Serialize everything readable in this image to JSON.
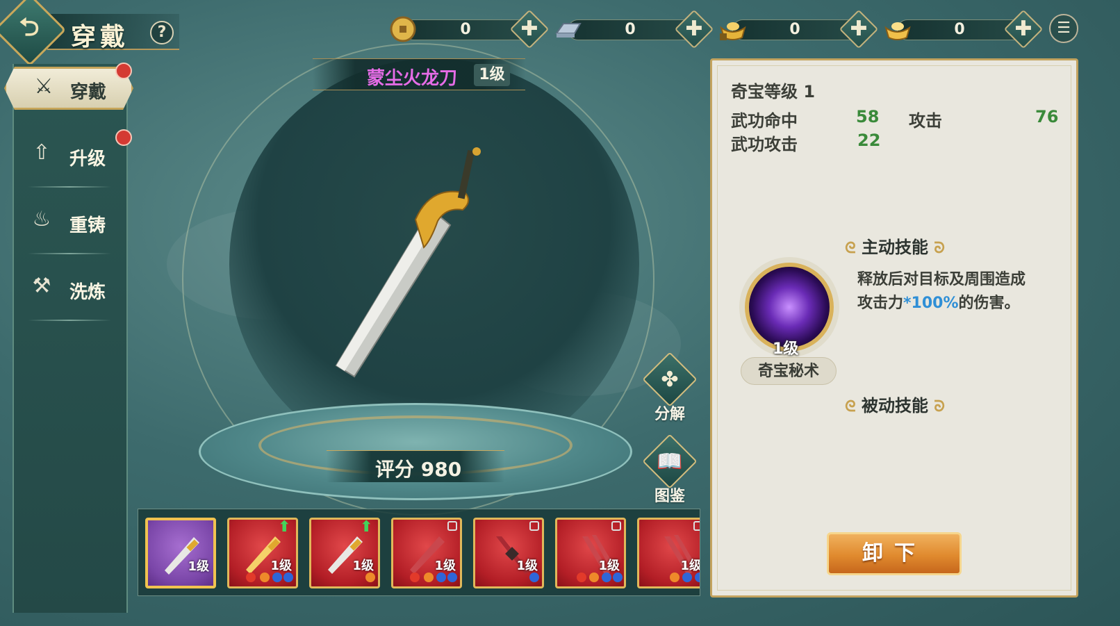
{
  "header": {
    "back_icon": "back-arrow-icon",
    "title": "穿戴",
    "help": "?"
  },
  "currencies": [
    {
      "icon": "copper-coin-icon",
      "value": "0",
      "color": "#e0b64a"
    },
    {
      "icon": "silver-ingot-icon",
      "value": "0",
      "color": "#b9c9da"
    },
    {
      "icon": "gold-ingot-locked-icon",
      "value": "0",
      "color": "#e6b43a"
    },
    {
      "icon": "gold-ingot-icon",
      "value": "0",
      "color": "#f1c04a"
    }
  ],
  "sidebar": {
    "items": [
      {
        "label": "穿戴",
        "icon": "crossed-swords-icon",
        "badge": true
      },
      {
        "label": "升级",
        "icon": "upgrade-arrow-icon",
        "badge": true
      },
      {
        "label": "重铸",
        "icon": "flame-icon",
        "badge": false
      },
      {
        "label": "洗炼",
        "icon": "anvil-icon",
        "badge": false
      }
    ]
  },
  "item": {
    "name": "蒙尘火龙刀",
    "level": "1级",
    "score": "评分 980",
    "name_color": "#e56ce6"
  },
  "actions": {
    "decompose": "分解",
    "codex": "图鉴"
  },
  "inventory": [
    {
      "level": "1级",
      "rarity": "purple",
      "selected": true
    },
    {
      "level": "1级",
      "rarity": "red",
      "upgradable": true
    },
    {
      "level": "1级",
      "rarity": "red",
      "upgradable": true
    },
    {
      "level": "1级",
      "rarity": "red",
      "locked": true
    },
    {
      "level": "1级",
      "rarity": "red",
      "locked": true
    },
    {
      "level": "1级",
      "rarity": "red",
      "locked": true
    },
    {
      "level": "1级",
      "rarity": "red",
      "locked": true
    }
  ],
  "panel": {
    "treasure_level": "奇宝等级 1",
    "stats": [
      {
        "name": "武功命中",
        "value": "58"
      },
      {
        "name": "攻击",
        "value": "76"
      },
      {
        "name": "武功攻击",
        "value": "22"
      }
    ],
    "active_skill_header": "主动技能",
    "skill": {
      "level": "1级",
      "name": "奇宝秘术",
      "desc_line1": "释放后对目标及周围造成",
      "desc_line2_pre": "攻击力",
      "desc_line2_highlight": "*100%",
      "desc_line2_post": "的伤害。"
    },
    "passive_skill_header": "被动技能",
    "unequip_label": "卸下"
  }
}
